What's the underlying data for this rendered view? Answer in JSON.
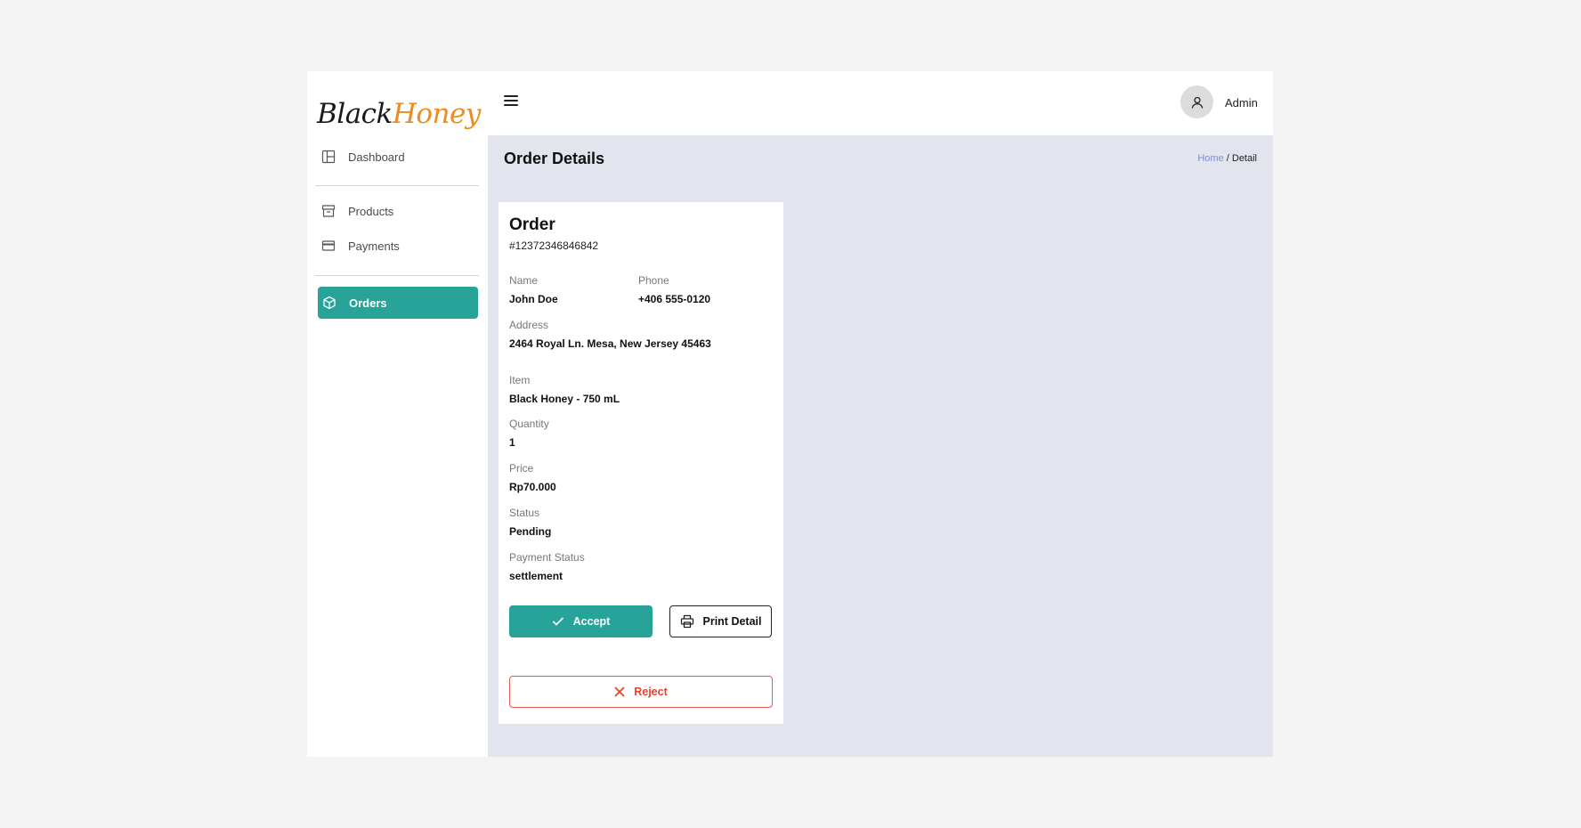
{
  "brand": {
    "part1": "Black",
    "part2": "Honey"
  },
  "sidebar": {
    "items": [
      {
        "label": "Dashboard"
      },
      {
        "label": "Products"
      },
      {
        "label": "Payments"
      },
      {
        "label": "Orders"
      }
    ],
    "active": "Orders"
  },
  "header": {
    "user_name": "Admin"
  },
  "page": {
    "title": "Order Details",
    "breadcrumb": {
      "home": "Home",
      "separator": " / ",
      "current": "Detail"
    }
  },
  "order": {
    "title": "Order",
    "id": "#12372346846842",
    "fields": {
      "name_label": "Name",
      "name": "John Doe",
      "phone_label": "Phone",
      "phone": "+406 555-0120",
      "address_label": "Address",
      "address": "2464 Royal Ln. Mesa, New Jersey 45463",
      "item_label": "Item",
      "item": "Black Honey - 750 mL",
      "quantity_label": "Quantity",
      "quantity": "1",
      "price_label": "Price",
      "price": "Rp70.000",
      "status_label": "Status",
      "status": "Pending",
      "payment_status_label": "Payment Status",
      "payment_status": "settlement"
    },
    "actions": {
      "accept": "Accept",
      "print": "Print Detail",
      "reject": "Reject"
    }
  },
  "colors": {
    "accent": "#27a39a",
    "brand_orange": "#ef8a1e",
    "danger": "#e0442f",
    "content_bg": "#e2e5ee",
    "link": "#7b8fd6"
  },
  "icons": {
    "dashboard": "layout-icon",
    "products": "archive-box-icon",
    "payments": "credit-card-icon",
    "orders": "cube-icon",
    "menu": "hamburger-icon",
    "user": "user-icon",
    "accept": "check-icon",
    "print": "printer-icon",
    "reject": "x-icon"
  }
}
